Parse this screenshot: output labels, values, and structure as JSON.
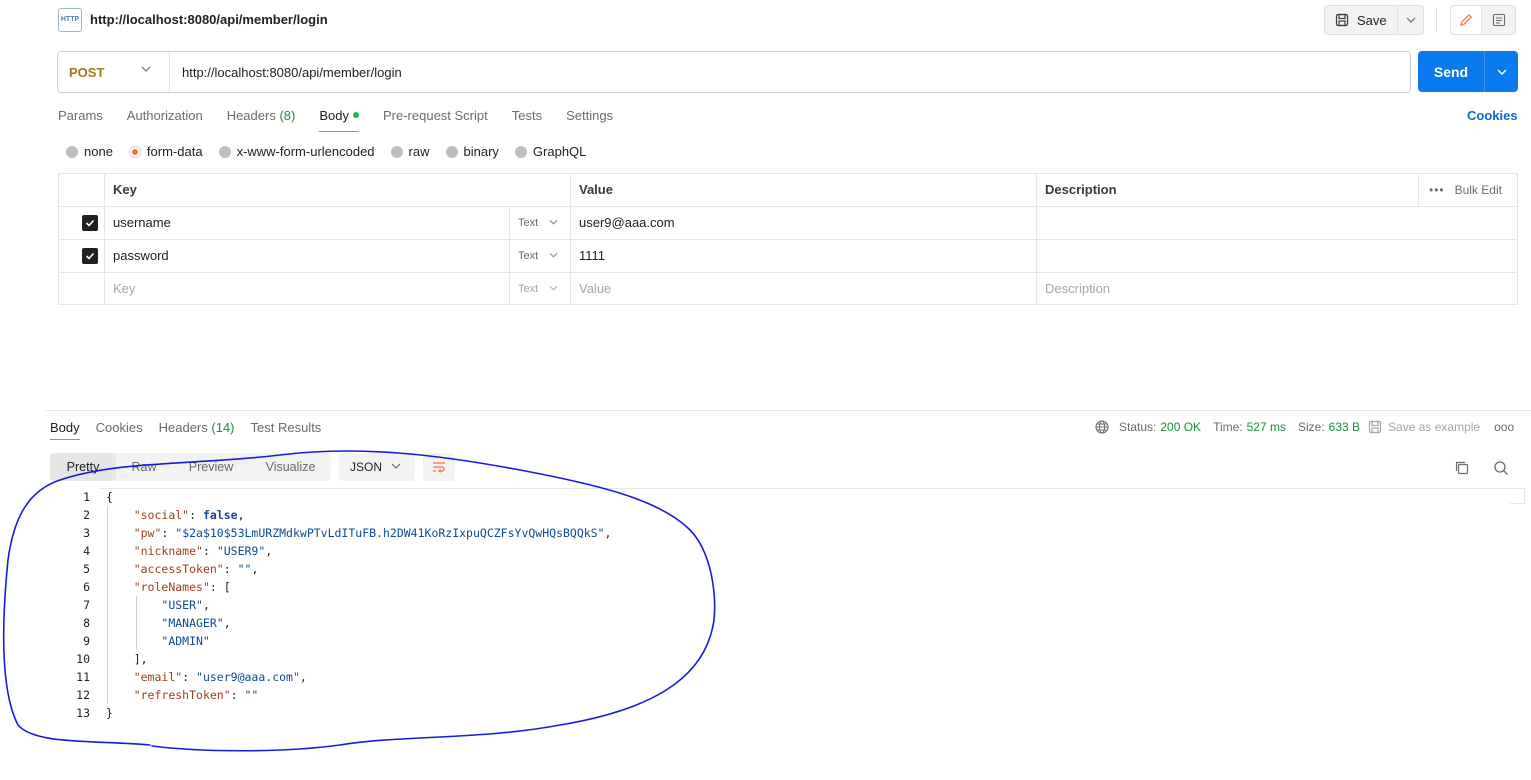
{
  "request": {
    "title": "http://localhost:8080/api/member/login",
    "http_badge": "HTTP",
    "save_label": "Save",
    "method": "POST",
    "url": "http://localhost:8080/api/member/login",
    "send_label": "Send",
    "tabs": [
      {
        "label": "Params"
      },
      {
        "label": "Authorization"
      },
      {
        "label": "Headers",
        "count": "(8)"
      },
      {
        "label": "Body"
      },
      {
        "label": "Pre-request Script"
      },
      {
        "label": "Tests"
      },
      {
        "label": "Settings"
      }
    ],
    "cookies_label": "Cookies",
    "body_types": [
      "none",
      "form-data",
      "x-www-form-urlencoded",
      "raw",
      "binary",
      "GraphQL"
    ],
    "table": {
      "headers": {
        "key": "Key",
        "value": "Value",
        "description": "Description",
        "bulk_edit": "Bulk Edit"
      },
      "rows": [
        {
          "key": "username",
          "type": "Text",
          "value": "user9@aaa.com"
        },
        {
          "key": "password",
          "type": "Text",
          "value": "1111"
        }
      ],
      "placeholder": {
        "key": "Key",
        "type": "Text",
        "value": "Value",
        "description": "Description"
      }
    }
  },
  "response": {
    "tabs": [
      {
        "label": "Body"
      },
      {
        "label": "Cookies"
      },
      {
        "label": "Headers",
        "count": "(14)"
      },
      {
        "label": "Test Results"
      }
    ],
    "status_label": "Status:",
    "status_value": "200 OK",
    "time_label": "Time:",
    "time_value": "527 ms",
    "size_label": "Size:",
    "size_value": "633 B",
    "save_example": "Save as example",
    "views": [
      "Pretty",
      "Raw",
      "Preview",
      "Visualize"
    ],
    "format": "JSON",
    "lines": [
      "1",
      "2",
      "3",
      "4",
      "5",
      "6",
      "7",
      "8",
      "9",
      "10",
      "11",
      "12",
      "13"
    ],
    "json": {
      "social_key": "\"social\"",
      "social_val": "false",
      "pw_key": "\"pw\"",
      "pw_val": "\"$2a$10$53LmURZMdkwPTvLdITuFB.h2DW41KoRzIxpuQCZFsYvQwHQsBQQkS\"",
      "nickname_key": "\"nickname\"",
      "nickname_val": "\"USER9\"",
      "accessToken_key": "\"accessToken\"",
      "accessToken_val": "\"\"",
      "roleNames_key": "\"roleNames\"",
      "role_user": "\"USER\"",
      "role_manager": "\"MANAGER\"",
      "role_admin": "\"ADMIN\"",
      "email_key": "\"email\"",
      "email_val": "\"user9@aaa.com\"",
      "refreshToken_key": "\"refreshToken\"",
      "refreshToken_val": "\"\""
    }
  },
  "colors": {
    "accent": "#ff6c37",
    "send": "#097bed",
    "status_green": "#1b8f3e",
    "annotation": "#1a1adc"
  }
}
